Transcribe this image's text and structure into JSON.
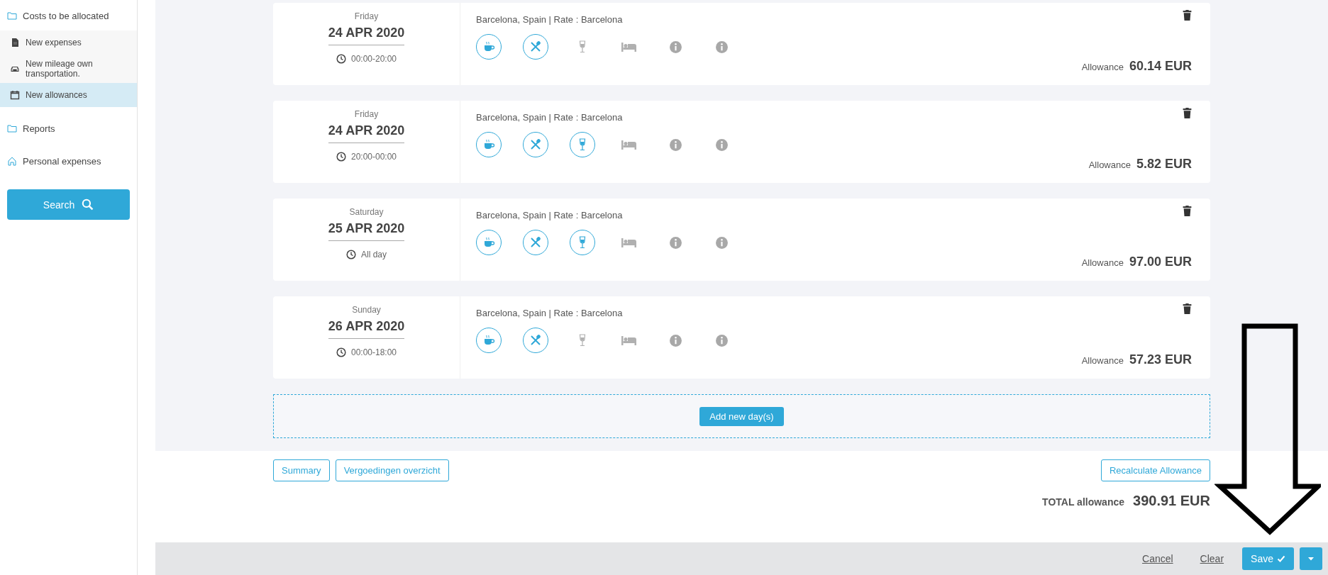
{
  "sidebar": {
    "items": [
      {
        "label": "Costs to be allocated",
        "kind": "folder",
        "selected": false,
        "children": [
          {
            "label": "New expenses",
            "kind": "document",
            "selected": false
          },
          {
            "label": "New mileage own transportation.",
            "kind": "car",
            "selected": false
          },
          {
            "label": "New allowances",
            "kind": "calendar",
            "selected": true
          }
        ]
      },
      {
        "label": "Reports",
        "kind": "folder",
        "selected": false
      },
      {
        "label": "Personal expenses",
        "kind": "home",
        "selected": false
      }
    ],
    "search_button": "Search"
  },
  "days": [
    {
      "weekday": "Friday",
      "date": "24 APR 2020",
      "time": "00:00-20:00",
      "location": "Barcelona, Spain | Rate : Barcelona",
      "meals": [
        {
          "kind": "breakfast",
          "checked": true
        },
        {
          "kind": "lunch",
          "checked": true
        },
        {
          "kind": "dinner",
          "checked": false
        },
        {
          "kind": "lodging",
          "checked": false
        },
        {
          "kind": "info"
        },
        {
          "kind": "info"
        }
      ],
      "allowance_label": "Allowance",
      "amount": "60.14 EUR"
    },
    {
      "weekday": "Friday",
      "date": "24 APR 2020",
      "time": "20:00-00:00",
      "location": "Barcelona, Spain | Rate : Barcelona",
      "meals": [
        {
          "kind": "breakfast",
          "checked": true
        },
        {
          "kind": "lunch",
          "checked": true
        },
        {
          "kind": "dinner",
          "checked": true
        },
        {
          "kind": "lodging",
          "checked": false
        },
        {
          "kind": "info"
        },
        {
          "kind": "info"
        }
      ],
      "allowance_label": "Allowance",
      "amount": "5.82 EUR"
    },
    {
      "weekday": "Saturday",
      "date": "25 APR 2020",
      "time": "All day",
      "location": "Barcelona, Spain | Rate : Barcelona",
      "meals": [
        {
          "kind": "breakfast",
          "checked": true
        },
        {
          "kind": "lunch",
          "checked": true
        },
        {
          "kind": "dinner",
          "checked": true
        },
        {
          "kind": "lodging",
          "checked": false
        },
        {
          "kind": "info"
        },
        {
          "kind": "info"
        }
      ],
      "allowance_label": "Allowance",
      "amount": "97.00 EUR"
    },
    {
      "weekday": "Sunday",
      "date": "26 APR 2020",
      "time": "00:00-18:00",
      "location": "Barcelona, Spain | Rate : Barcelona",
      "meals": [
        {
          "kind": "breakfast",
          "checked": true
        },
        {
          "kind": "lunch",
          "checked": true
        },
        {
          "kind": "dinner",
          "checked": false
        },
        {
          "kind": "lodging",
          "checked": false
        },
        {
          "kind": "info"
        },
        {
          "kind": "info"
        }
      ],
      "allowance_label": "Allowance",
      "amount": "57.23 EUR"
    }
  ],
  "add_day_button": "Add new day(s)",
  "left_buttons": [
    "Summary",
    "Vergoedingen overzicht"
  ],
  "recalculate_button": "Recalculate Allowance",
  "total_label": "TOTAL allowance",
  "total": "390.91 EUR",
  "footer": {
    "cancel": "Cancel",
    "clear": "Clear",
    "save": "Save"
  }
}
